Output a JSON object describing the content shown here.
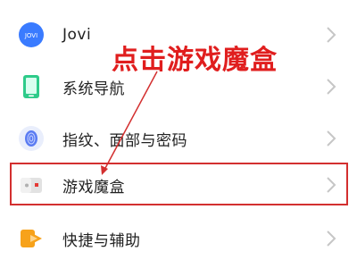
{
  "settings": {
    "items": [
      {
        "label": "Jovi",
        "icon": "jovi-app-icon"
      },
      {
        "label": "系统导航",
        "icon": "phone-icon"
      },
      {
        "label": "指纹、面部与密码",
        "icon": "fingerprint-icon"
      },
      {
        "label": "游戏魔盒",
        "icon": "game-box-icon"
      },
      {
        "label": "快捷与辅助",
        "icon": "shortcut-arrow-icon"
      }
    ],
    "jovi_icon_text": "JOVI"
  },
  "annotation": {
    "text": "点击游戏魔盒",
    "color": "#e01e1e"
  },
  "colors": {
    "highlight": "#d32f2f",
    "chevron": "#c6c6c6",
    "jovi_blue": "#3a7bff",
    "phone_green": "#2ecb8a",
    "fingerprint_blue": "#5b7cf2",
    "shortcut_orange": "#f7a21b"
  }
}
